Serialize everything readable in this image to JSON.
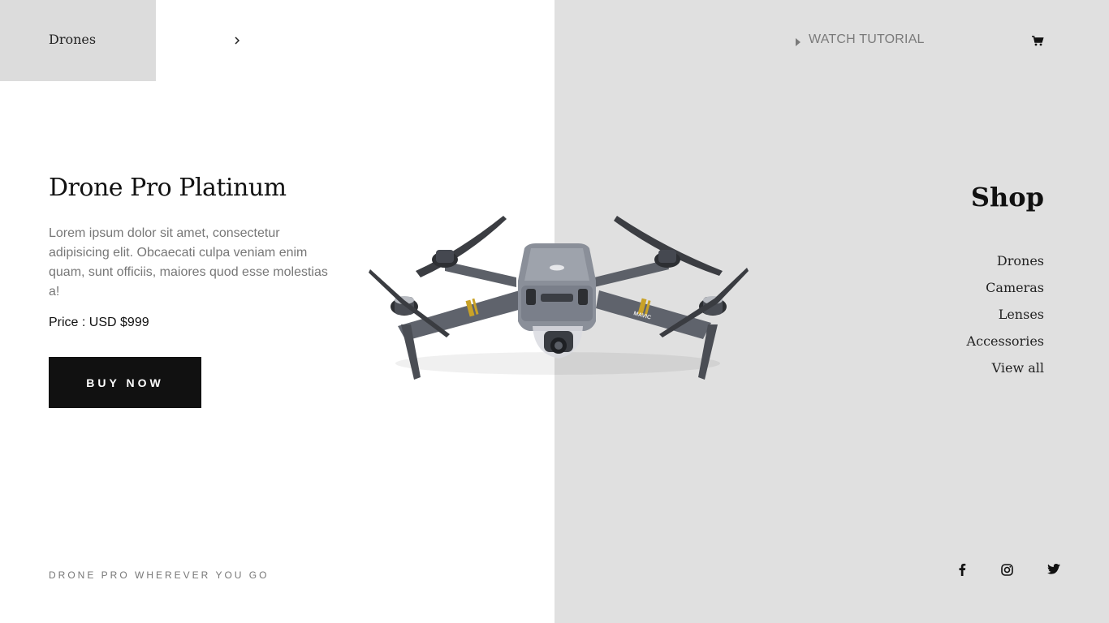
{
  "header": {
    "logo_text": "Drones",
    "watch_tutorial_label": "WATCH TUTORIAL"
  },
  "hero": {
    "title": "Drone Pro Platinum",
    "description": "Lorem ipsum dolor sit amet, consectetur adipisicing elit. Obcaecati culpa veniam enim quam, sunt officiis, maiores quod esse molestias a!",
    "price": "Price : USD $999",
    "buy_label": "BUY NOW",
    "drone_label": "MAVIC"
  },
  "shop": {
    "title": "Shop",
    "items": [
      "Drones",
      "Cameras",
      "Lenses",
      "Accessories",
      "View all"
    ]
  },
  "footer": {
    "tagline": "DRONE PRO WHEREVER YOU GO",
    "social_icons": [
      "facebook-icon",
      "instagram-icon",
      "twitter-icon"
    ]
  },
  "colors": {
    "right_panel": "#e0e0e0",
    "logo_box": "#dcdcdc",
    "button": "#111111",
    "muted_text": "#777777",
    "drone_body": "#7a7f8a",
    "drone_accent": "#c9a227"
  }
}
